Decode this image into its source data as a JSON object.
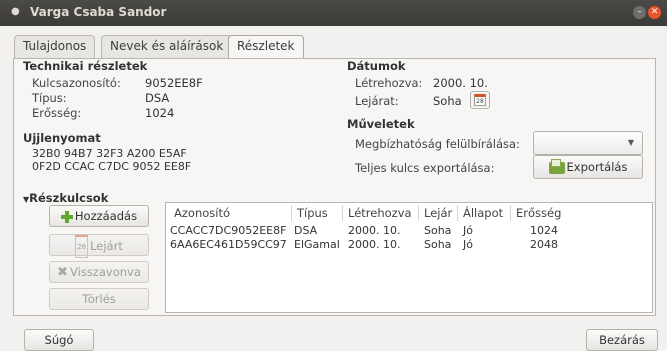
{
  "window": {
    "title": "Varga Csaba Sandor"
  },
  "tabs": [
    {
      "label": "Tulajdonos"
    },
    {
      "label": "Nevek és aláírások"
    },
    {
      "label": "Részletek"
    }
  ],
  "technical": {
    "heading": "Technikai részletek",
    "keyid_label": "Kulcsazonosító:",
    "keyid_value": "9052EE8F",
    "type_label": "Típus:",
    "type_value": "DSA",
    "strength_label": "Erősség:",
    "strength_value": "1024"
  },
  "dates": {
    "heading": "Dátumok",
    "created_label": "Létrehozva:",
    "created_value": "2000. 10.",
    "expiry_label": "Lejárat:",
    "expiry_value": "Soha",
    "calendar_glyph": "28"
  },
  "fingerprint": {
    "heading": "Ujjlenyomat",
    "line1": "32B0 94B7 32F3 A200 E5AF",
    "line2": "0F2D CCAC C7DC 9052 EE8F"
  },
  "operations": {
    "heading": "Műveletek",
    "trust_label": "Megbízhatóság felülbírálása:",
    "trust_value": "",
    "export_label": "Teljes kulcs exportálása:",
    "export_button": "Exportálás"
  },
  "subkeys": {
    "heading": "Részkulcsok",
    "add_button": "Hozzáadás",
    "expire_button": "Lejárt",
    "expire_glyph": "28",
    "revoke_button": "Visszavonva",
    "delete_button": "Törlés",
    "columns": [
      "Azonosító",
      "Típus",
      "Létrehozva",
      "Lejár",
      "Állapot",
      "Erősség"
    ],
    "rows": [
      [
        "CCACC7DC9052EE8F",
        "DSA",
        "2000. 10.",
        "Soha",
        "Jó",
        "1024"
      ],
      [
        "6AA6EC461D59CC97",
        "ElGamal",
        "2000. 10.",
        "Soha",
        "Jó",
        "2048"
      ]
    ]
  },
  "footer": {
    "help_button": "Súgó",
    "close_button": "Bezárás"
  },
  "colors": {
    "titlebar": "#3c3b37",
    "close_button": "#e9552b",
    "add_icon": "#5ea82f",
    "calendar_accent": "#d24f2a"
  }
}
